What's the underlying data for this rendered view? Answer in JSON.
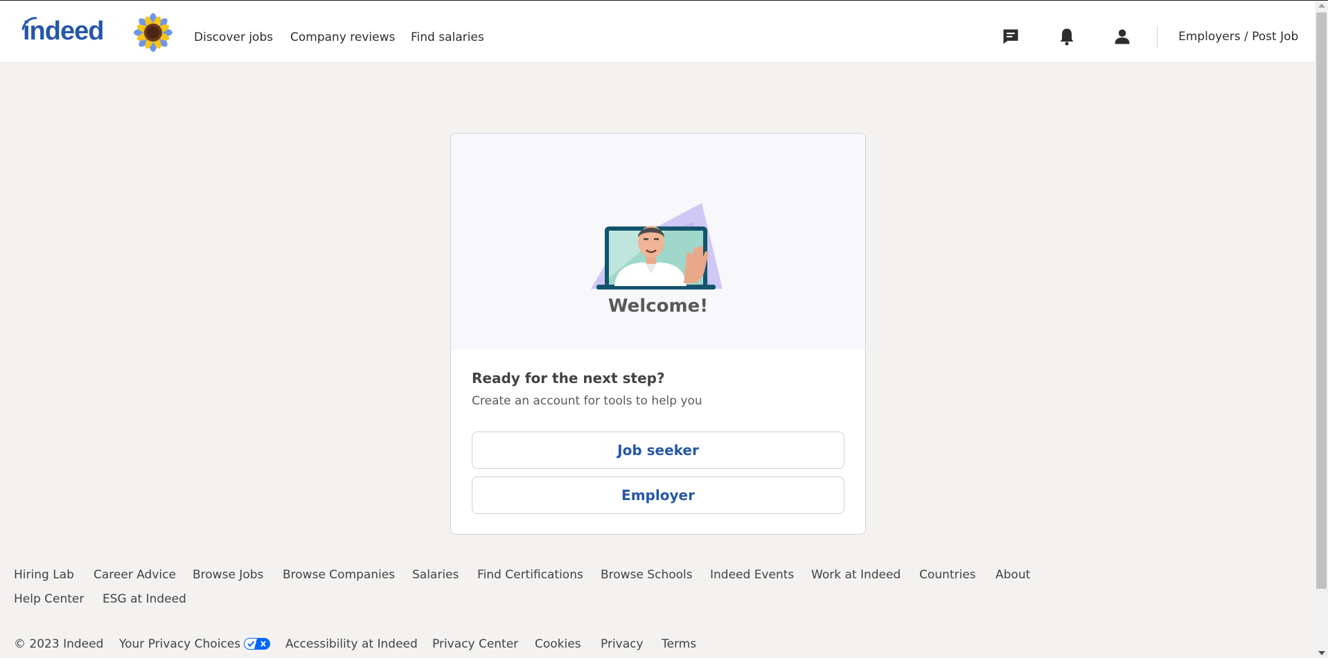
{
  "header": {
    "logo_text": "indeed",
    "nav": [
      "Discover jobs",
      "Company reviews",
      "Find salaries"
    ],
    "icons": [
      "chat-icon",
      "bell-icon",
      "user-icon"
    ],
    "employers_link": "Employers / Post Job"
  },
  "card": {
    "welcome": "Welcome!",
    "heading": "Ready for the next step?",
    "subtext": "Create an account for tools to help you",
    "job_seeker_button": "Job seeker",
    "employer_button": "Employer"
  },
  "footer": {
    "links_row1": [
      "Hiring Lab",
      "Career Advice",
      "Browse Jobs",
      "Browse Companies",
      "Salaries",
      "Find Certifications",
      "Browse Schools",
      "Indeed Events",
      "Work at Indeed",
      "Countries",
      "About"
    ],
    "links_row2": [
      "Help Center",
      "ESG at Indeed"
    ],
    "copyright": "© 2023 Indeed",
    "legal_links": [
      "Your Privacy Choices",
      "Accessibility at Indeed",
      "Privacy Center",
      "Cookies",
      "Privacy",
      "Terms"
    ]
  },
  "colors": {
    "brand_blue": "#2557a7",
    "page_background": "#f3f2f1",
    "hero_background": "#f7f7fc"
  }
}
